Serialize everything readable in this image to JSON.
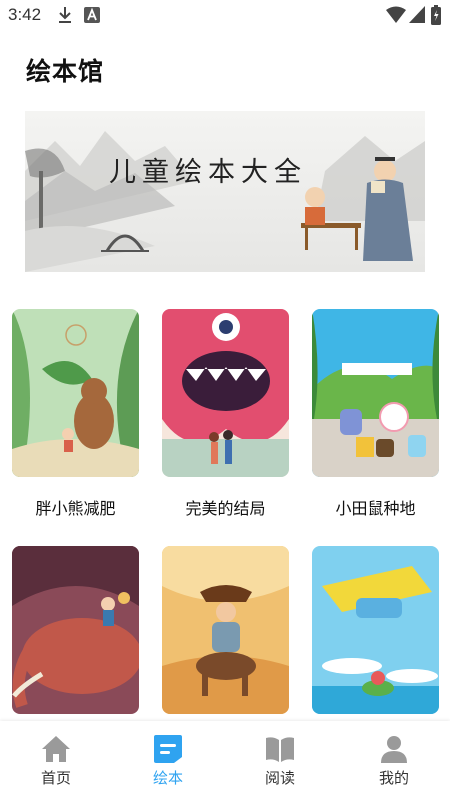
{
  "status_bar": {
    "time": "3:42"
  },
  "header": {
    "title": "绘本馆"
  },
  "banner": {
    "title": "儿童绘本大全"
  },
  "books": [
    {
      "title": "胖小熊减肥"
    },
    {
      "title": "完美的结局"
    },
    {
      "title": "小田鼠种地"
    },
    {
      "title": ""
    },
    {
      "title": ""
    },
    {
      "title": ""
    }
  ],
  "tabs": [
    {
      "label": "首页",
      "icon": "home-icon",
      "active": false
    },
    {
      "label": "绘本",
      "icon": "picture-book-icon",
      "active": true
    },
    {
      "label": "阅读",
      "icon": "open-book-icon",
      "active": false
    },
    {
      "label": "我的",
      "icon": "person-icon",
      "active": false
    }
  ],
  "colors": {
    "accent": "#2fa3f0",
    "inactive_icon": "#9a9a9a"
  }
}
